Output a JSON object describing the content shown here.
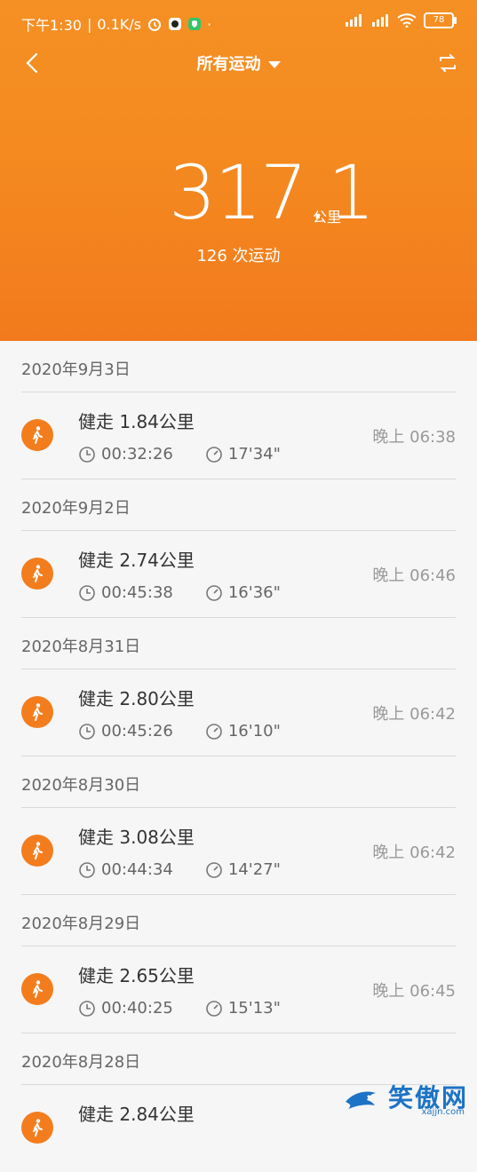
{
  "statusbar": {
    "time": "下午1:30",
    "speed": "0.1K/s",
    "battery": "78"
  },
  "nav": {
    "title": "所有运动"
  },
  "summary": {
    "total": "317.1",
    "unit": "公里",
    "count": "126 次运动"
  },
  "groups": [
    {
      "date": "2020年9月3日",
      "items": [
        {
          "activity": "健走 1.84公里",
          "duration": "00:32:26",
          "pace": "17'34\"",
          "time": "晚上 06:38"
        }
      ]
    },
    {
      "date": "2020年9月2日",
      "items": [
        {
          "activity": "健走 2.74公里",
          "duration": "00:45:38",
          "pace": "16'36\"",
          "time": "晚上 06:46"
        }
      ]
    },
    {
      "date": "2020年8月31日",
      "items": [
        {
          "activity": "健走 2.80公里",
          "duration": "00:45:26",
          "pace": "16'10\"",
          "time": "晚上 06:42"
        }
      ]
    },
    {
      "date": "2020年8月30日",
      "items": [
        {
          "activity": "健走 3.08公里",
          "duration": "00:44:34",
          "pace": "14'27\"",
          "time": "晚上 06:42"
        }
      ]
    },
    {
      "date": "2020年8月29日",
      "items": [
        {
          "activity": "健走 2.65公里",
          "duration": "00:40:25",
          "pace": "15'13\"",
          "time": "晚上 06:45"
        }
      ]
    },
    {
      "date": "2020年8月28日",
      "items": [
        {
          "activity": "健走 2.84公里",
          "duration": "",
          "pace": "",
          "time": ""
        }
      ]
    }
  ],
  "watermark": {
    "text": "笑傲网",
    "sub": "xajjn.com"
  }
}
